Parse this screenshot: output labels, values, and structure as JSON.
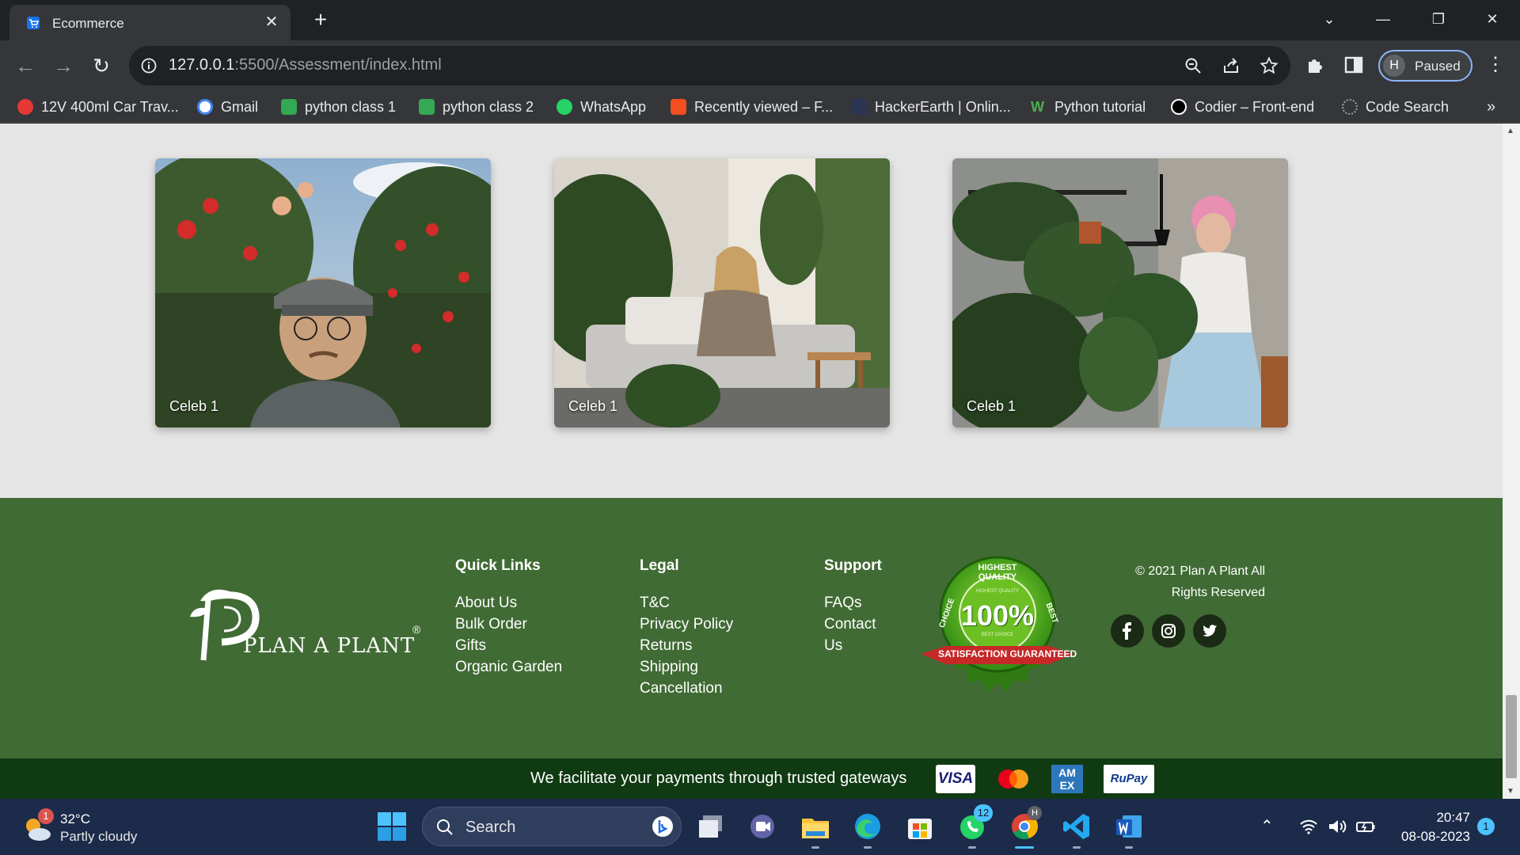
{
  "browser": {
    "tab_title": "Ecommerce",
    "url_host": "127.0.0.1",
    "url_rest": ":5500/Assessment/index.html",
    "profile_initial": "H",
    "profile_status": "Paused",
    "bookmarks": [
      {
        "label": "12V 400ml Car Trav...",
        "color": "#e53935"
      },
      {
        "label": "Gmail",
        "color": "#ffffff"
      },
      {
        "label": "python class 1",
        "color": "#34a853"
      },
      {
        "label": "python class 2",
        "color": "#34a853"
      },
      {
        "label": "WhatsApp",
        "color": "#25d366"
      },
      {
        "label": "Recently viewed – F...",
        "color": "#f24e1e"
      },
      {
        "label": "HackerEarth | Onlin...",
        "color": "#2c3454"
      },
      {
        "label": "Python tutorial",
        "color": "#4caf50"
      },
      {
        "label": "Codier – Front-end",
        "color": "#000000"
      },
      {
        "label": "Code Search",
        "color": "#9aa0a6"
      }
    ],
    "more_bookmarks": "»"
  },
  "gallery": {
    "cards": [
      {
        "caption": "Celeb 1"
      },
      {
        "caption": "Celeb 1"
      },
      {
        "caption": "Celeb 1"
      }
    ]
  },
  "footer": {
    "logo_text": "PLAN A PLANT",
    "logo_mark": "®",
    "columns": [
      {
        "heading": "Quick Links",
        "links": [
          "About Us",
          "Bulk Order",
          "Gifts",
          "Organic Garden"
        ]
      },
      {
        "heading": "Legal",
        "links": [
          "T&C",
          "Privacy Policy",
          "Returns",
          "Shipping",
          "Cancellation"
        ]
      },
      {
        "heading": "Support",
        "links": [
          "FAQs",
          "Contact",
          "Us"
        ]
      }
    ],
    "badge": {
      "top": "HIGHEST QUALITY",
      "left": "CHOICE",
      "right": "BEST",
      "center": "100%",
      "small_top": "HIGHEST QUALITY",
      "small_bottom": "BEST CHOICE",
      "ribbon": "SATISFACTION GUARANTEED"
    },
    "copyright_line1": "© 2021 Plan A Plant All",
    "copyright_line2": "Rights Reserved",
    "social": [
      "facebook-icon",
      "instagram-icon",
      "twitter-icon"
    ],
    "payments_text": "We facilitate your payments through trusted gateways",
    "payment_cards": [
      "VISA",
      "Mastercard",
      "AM EX",
      "RuPay"
    ]
  },
  "taskbar": {
    "weather_temp": "32°C",
    "weather_desc": "Partly cloudy",
    "weather_badge": "1",
    "search_label": "Search",
    "whatsapp_badge": "12",
    "chrome_badge": "H",
    "time": "20:47",
    "date": "08-08-2023",
    "notification_count": "1"
  },
  "colors": {
    "footer_green": "#406b34",
    "paybar_green": "#103a12",
    "page_bg": "#e5e5e5",
    "taskbar": "#1c2b4a"
  }
}
